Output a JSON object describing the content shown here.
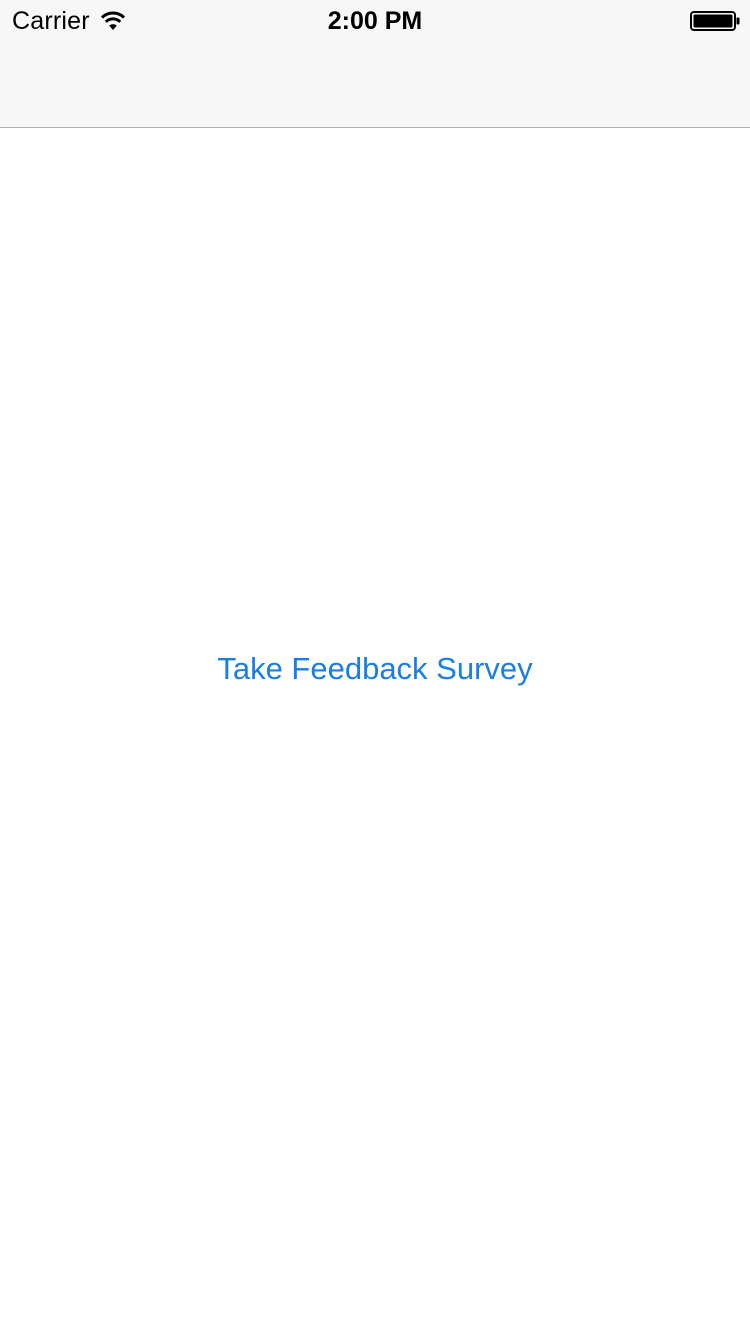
{
  "status_bar": {
    "carrier": "Carrier",
    "time": "2:00 PM",
    "wifi_icon": "wifi-icon",
    "battery_icon": "battery-full-icon"
  },
  "main": {
    "survey_button_label": "Take Feedback Survey"
  },
  "colors": {
    "accent": "#1a7ee4",
    "nav_background": "#f7f7f7",
    "nav_border": "#b2b2b2",
    "background": "#ffffff"
  }
}
